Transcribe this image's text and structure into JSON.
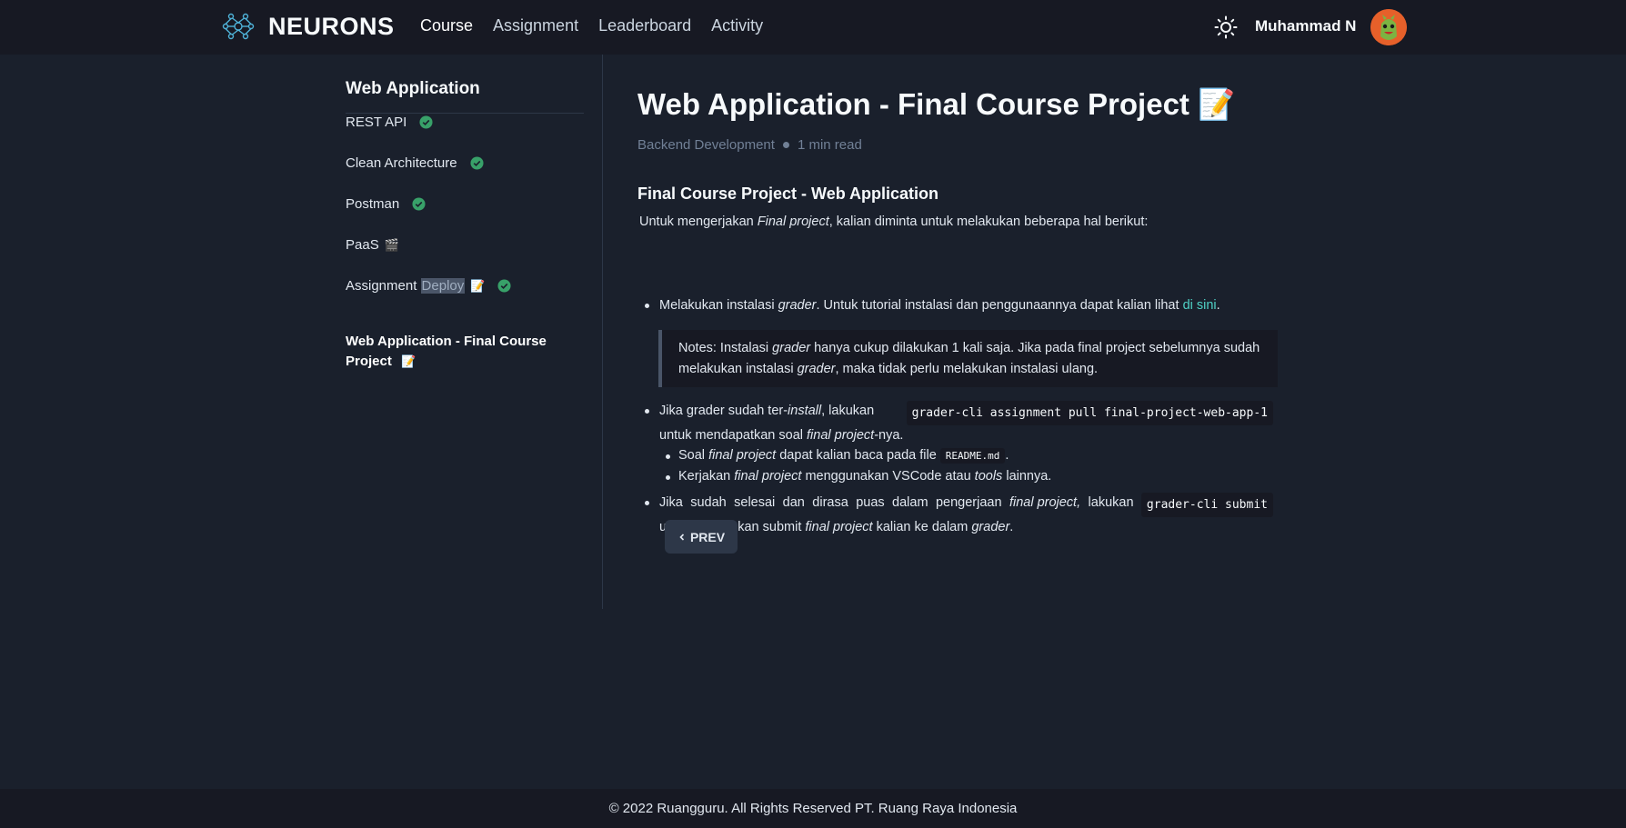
{
  "header": {
    "logo_text": "NEURONS",
    "nav": [
      {
        "label": "Course",
        "active": true
      },
      {
        "label": "Assignment",
        "active": false
      },
      {
        "label": "Leaderboard",
        "active": false
      },
      {
        "label": "Activity",
        "active": false
      }
    ],
    "theme_icon": "sun-icon",
    "username": "Muhammad N"
  },
  "sidebar": {
    "title": "Web Application",
    "items": [
      {
        "label": "REST API",
        "status": "completed"
      },
      {
        "label": "Clean Architecture",
        "status": "completed"
      },
      {
        "label": "Postman",
        "status": "completed"
      },
      {
        "label": "PaaS",
        "emoji": "🎬",
        "status": "none"
      },
      {
        "label": "Assignment ",
        "highlight": "Deploy",
        "emoji": "📝",
        "status": "completed"
      },
      {
        "label": "Web Application - Final Course Project",
        "emoji": "📝",
        "status": "active"
      }
    ]
  },
  "content": {
    "title": "Web Application - Final Course Project 📝",
    "category": "Backend Development",
    "read_time": "1 min read",
    "section_title": "Final Course Project - Web Application",
    "intro_pre": "Untuk mengerjakan ",
    "intro_em": "Final project",
    "intro_post": ", kalian diminta untuk melakukan beberapa hal berikut:",
    "b1_pre": "Melakukan instalasi ",
    "b1_em": "grader",
    "b1_post": ". Untuk tutorial instalasi dan penggunaannya dapat kalian lihat ",
    "b1_link": "di sini",
    "b1_end": ".",
    "note_pre": "Notes: Instalasi ",
    "note_em1": "grader",
    "note_mid": " hanya cukup dilakukan 1 kali saja. Jika pada final project sebelumnya sudah melakukan instalasi ",
    "note_em2": "grader",
    "note_post": ", maka tidak perlu melakukan instalasi ulang.",
    "b2_pre": "Jika grader sudah ter-",
    "b2_em": "install",
    "b2_mid": ", lakukan",
    "b2_code": "grader-cli assignment pull final-project-web-app-1",
    "b2_line2_pre": "untuk mendapatkan soal ",
    "b2_line2_em": "final project",
    "b2_line2_post": "-nya.",
    "s1_pre": "Soal ",
    "s1_em": "final project",
    "s1_mid": " dapat kalian baca pada file ",
    "s1_code": "README.md",
    "s1_post": ".",
    "s2_pre": "Kerjakan ",
    "s2_em": "final project",
    "s2_mid": " menggunakan VSCode atau ",
    "s2_em2": "tools",
    "s2_post": " lainnya.",
    "b3_w1": "Jika",
    "b3_w2": "sudah",
    "b3_w3": "selesai",
    "b3_w4": "dan",
    "b3_w5": "dirasa",
    "b3_w6": "puas",
    "b3_w7": "dalam",
    "b3_w8": "pengerjaan",
    "b3_w9": "final project,",
    "b3_w10": "lakukan",
    "b3_code": "grader-cli submit",
    "b3_line2_pre": "untuk melakukan submit ",
    "b3_line2_em": "final project",
    "b3_line2_mid": " kalian ke dalam ",
    "b3_line2_em2": "grader",
    "b3_line2_post": ".",
    "prev_label": "PREV"
  },
  "footer": {
    "text": "© 2022 Ruangguru. All Rights Reserved PT. Ruang Raya Indonesia"
  },
  "colors": {
    "background": "#1a202c",
    "topbar": "#171923",
    "check_green": "#38a169",
    "link": "#4fd1c5"
  }
}
